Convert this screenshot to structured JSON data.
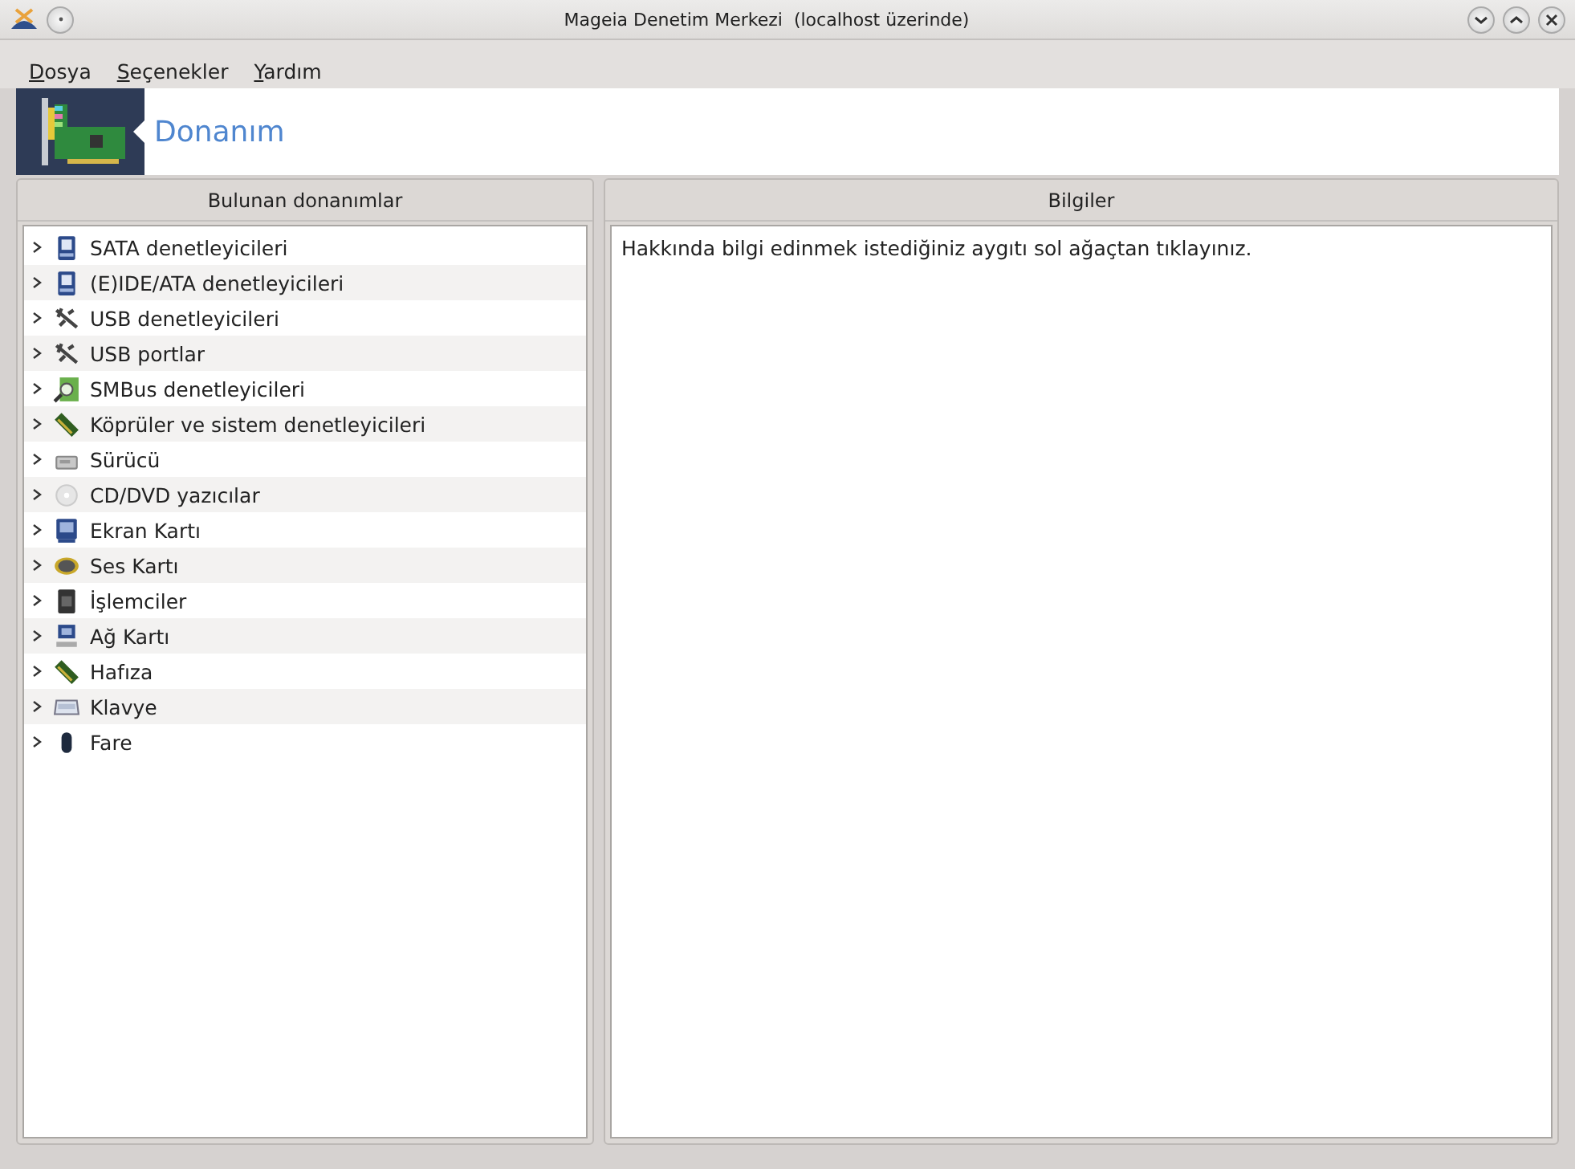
{
  "window": {
    "title": "Mageia Denetim Merkezi  (localhost üzerinde)"
  },
  "menu": [
    "Dosya",
    "Seçenekler",
    "Yardım"
  ],
  "banner": {
    "title": "Donanım"
  },
  "tree": {
    "header": "Bulunan donanımlar",
    "items": [
      {
        "label": "SATA denetleyicileri",
        "expanded": false
      },
      {
        "label": "(E)IDE/ATA denetleyicileri",
        "expanded": false
      },
      {
        "label": "USB denetleyicileri",
        "expanded": false
      },
      {
        "label": "USB portlar",
        "expanded": false
      },
      {
        "label": "SMBus denetleyicileri",
        "expanded": false
      },
      {
        "label": "Köprüler ve sistem denetleyicileri",
        "expanded": false
      },
      {
        "label": "Sürücü",
        "expanded": false
      },
      {
        "label": "CD/DVD yazıcılar",
        "expanded": false
      },
      {
        "label": "Ekran Kartı",
        "expanded": false
      },
      {
        "label": "Ses Kartı",
        "expanded": false
      },
      {
        "label": "İşlemciler",
        "expanded": false
      },
      {
        "label": "Ağ Kartı",
        "expanded": false
      },
      {
        "label": "Hafıza",
        "expanded": false
      },
      {
        "label": "Klavye",
        "expanded": false
      },
      {
        "label": "Fare",
        "expanded": false
      }
    ]
  },
  "info": {
    "header": "Bilgiler",
    "text": "Hakkında bilgi edinmek istediğiniz aygıtı sol ağaçtan tıklayınız."
  }
}
